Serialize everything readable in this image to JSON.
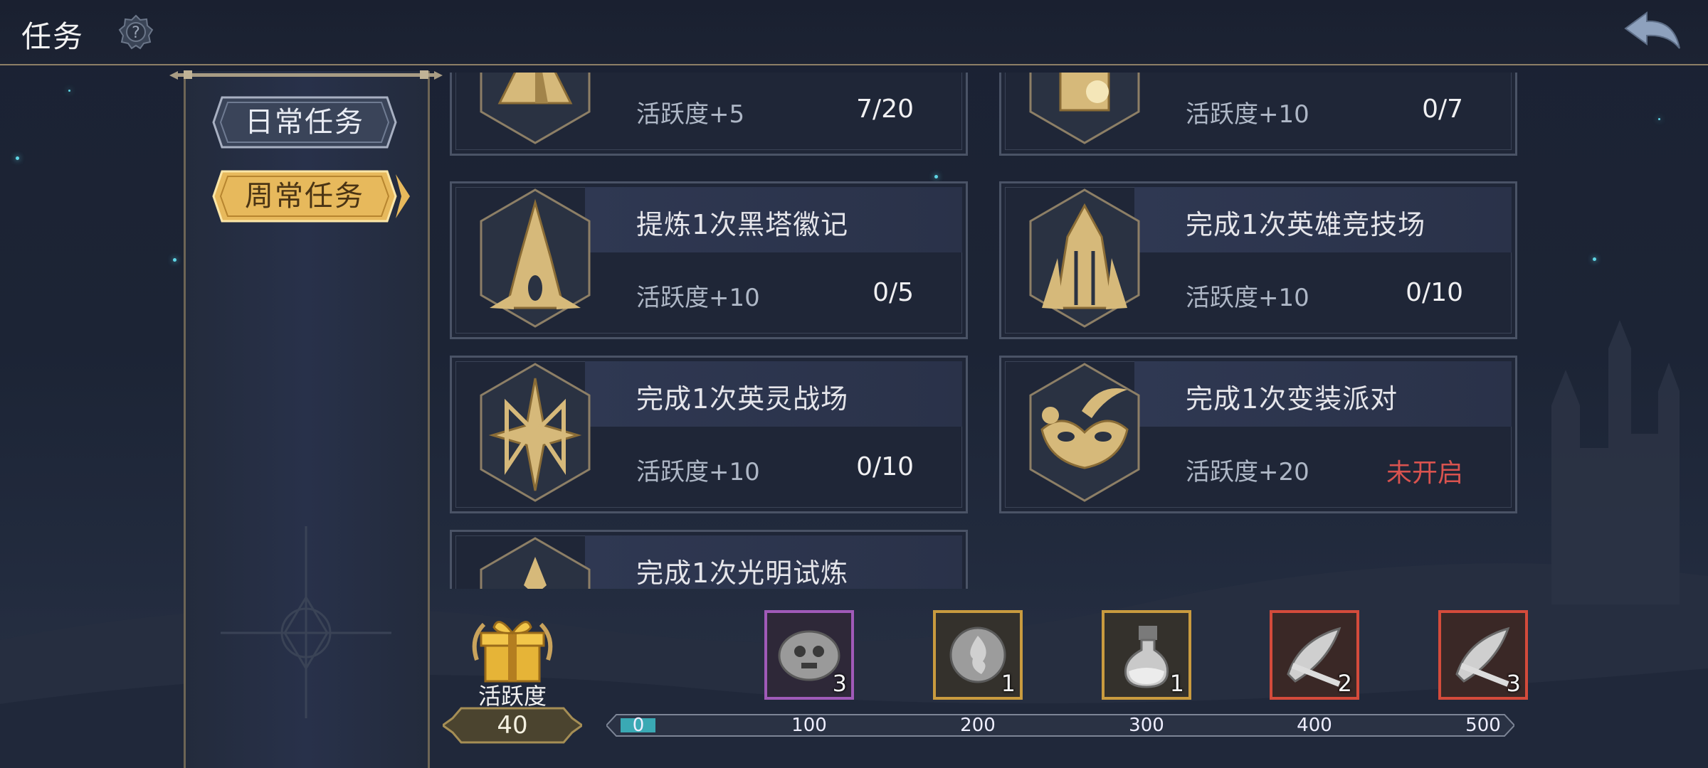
{
  "header": {
    "title": "任务",
    "help_icon": "question-gear-icon",
    "back_icon": "back-arrow-icon"
  },
  "sidebar": {
    "tabs": [
      {
        "label": "日常任务",
        "active": false
      },
      {
        "label": "周常任务",
        "active": true
      }
    ]
  },
  "tasks": [
    {
      "name": "",
      "reward": "活跃度+5",
      "progress": "7/20",
      "icon": "pyramid-emblem-icon"
    },
    {
      "name": "",
      "reward": "活跃度+10",
      "progress": "0/7",
      "icon": "sun-tower-emblem-icon"
    },
    {
      "name": "提炼1次黑塔徽记",
      "reward": "活跃度+10",
      "progress": "0/5",
      "icon": "black-tower-emblem-icon"
    },
    {
      "name": "完成1次英雄竞技场",
      "reward": "活跃度+10",
      "progress": "0/10",
      "icon": "knight-helm-emblem-icon"
    },
    {
      "name": "完成1次英灵战场",
      "reward": "活跃度+10",
      "progress": "0/10",
      "icon": "sword-star-emblem-icon"
    },
    {
      "name": "完成1次变装派对",
      "reward": "活跃度+20",
      "progress": "未开启",
      "icon": "masquerade-mask-emblem-icon",
      "locked": true
    },
    {
      "name": "完成1次光明试炼",
      "reward": "",
      "progress": "",
      "icon": "light-trial-emblem-icon"
    }
  ],
  "activity": {
    "label": "活跃度",
    "value": "40",
    "icon": "gift-box-icon",
    "progress_fraction": 0.04
  },
  "milestones": [
    {
      "threshold": "0"
    },
    {
      "threshold": "100",
      "reward_icon": "skull-token-icon",
      "count": "3",
      "rarity": "purple"
    },
    {
      "threshold": "200",
      "reward_icon": "flame-stone-icon",
      "count": "1",
      "rarity": "gold"
    },
    {
      "threshold": "300",
      "reward_icon": "potion-bottle-icon",
      "count": "1",
      "rarity": "gold"
    },
    {
      "threshold": "400",
      "reward_icon": "feather-crystal-icon",
      "count": "2",
      "rarity": "red"
    },
    {
      "threshold": "500",
      "reward_icon": "feather-crystal-icon",
      "count": "3",
      "rarity": "red"
    }
  ],
  "colors": {
    "gold": "#c99b3f",
    "purple": "#a05ab8",
    "red": "#d44b3b",
    "teal": "#3aa9b4",
    "locked": "#d9534f"
  }
}
